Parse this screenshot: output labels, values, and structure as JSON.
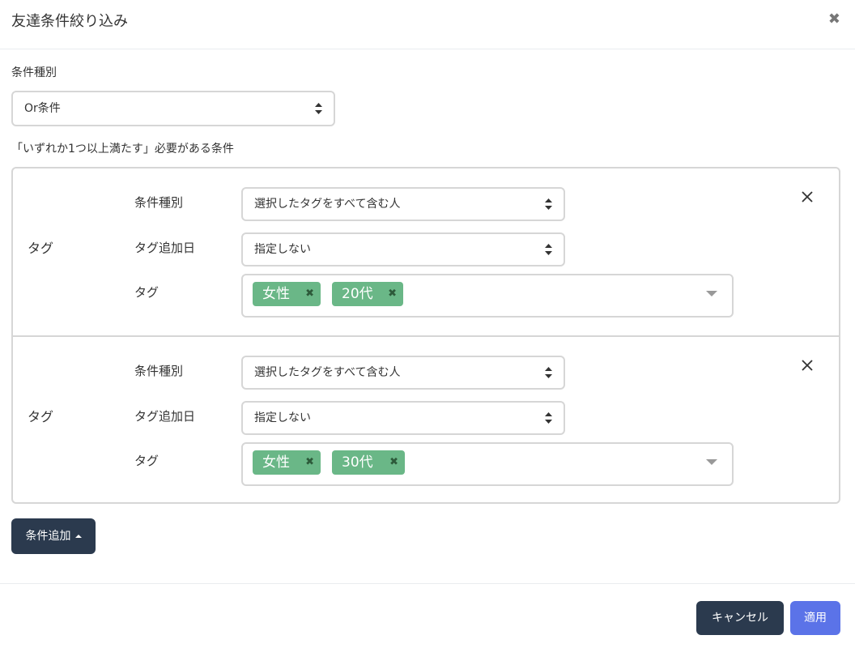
{
  "modal": {
    "title": "友達条件絞り込み",
    "close_symbol": "✖"
  },
  "condition_type": {
    "label": "条件種別",
    "selected": "Or条件"
  },
  "description": "「いずれか1つ以上満たす」必要がある条件",
  "conditions": [
    {
      "category": "タグ",
      "type_label": "条件種別",
      "type_value": "選択したタグをすべて含む人",
      "date_label": "タグ追加日",
      "date_value": "指定しない",
      "tags_label": "タグ",
      "tags": [
        "女性",
        "20代"
      ]
    },
    {
      "category": "タグ",
      "type_label": "条件種別",
      "type_value": "選択したタグをすべて含む人",
      "date_label": "タグ追加日",
      "date_value": "指定しない",
      "tags_label": "タグ",
      "tags": [
        "女性",
        "30代"
      ]
    }
  ],
  "chip_remove_symbol": "✖",
  "buttons": {
    "add_condition": "条件追加",
    "cancel": "キャンセル",
    "apply": "適用"
  },
  "colors": {
    "chip_bg": "#6ab787",
    "dark_button": "#2b3a4e",
    "primary_button": "#5b73e8",
    "border": "#d6d6d6"
  }
}
